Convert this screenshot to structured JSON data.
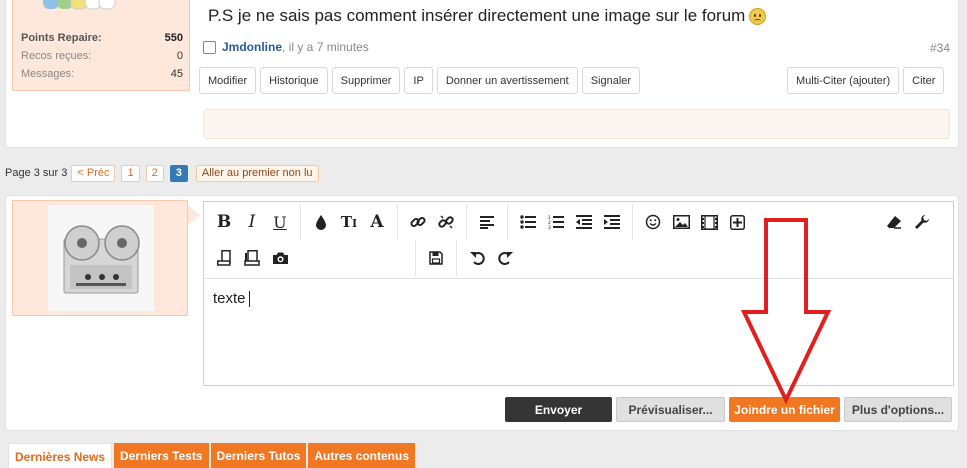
{
  "previous_post": {
    "user_stats": [
      {
        "label": "Points Repaire:",
        "value": "550",
        "bold": true
      },
      {
        "label": "Recos reçues:",
        "value": "0",
        "bold": false
      },
      {
        "label": "Messages:",
        "value": "45",
        "bold": false
      }
    ],
    "message": "P.S je ne sais pas comment insérer directement une image sur le forum",
    "emoji_icon": "worried-face-icon",
    "author": "Jmdonline",
    "time": ", il y a 7 minutes",
    "post_number": "#34",
    "actions_left": [
      "Modifier",
      "Historique",
      "Supprimer",
      "IP",
      "Donner un avertissement",
      "Signaler"
    ],
    "actions_right": [
      "Multi-Citer (ajouter)",
      "Citer"
    ]
  },
  "pagination": {
    "label": "Page 3 sur 3",
    "prev": "< Préc",
    "pages": [
      "1",
      "2",
      "3"
    ],
    "current": "3",
    "first_unread": "Aller au premier non lu"
  },
  "editor": {
    "toolbar_row1": [
      [
        "bold-icon",
        "italic-icon",
        "underline-icon"
      ],
      [
        "text-color-icon",
        "font-size-icon",
        "font-family-icon"
      ],
      [
        "link-icon",
        "unlink-icon"
      ],
      [
        "align-icon"
      ],
      [
        "bulleted-list-icon",
        "numbered-list-icon",
        "outdent-icon",
        "indent-icon"
      ],
      [
        "smilie-icon",
        "image-icon",
        "media-icon",
        "insert-icon"
      ]
    ],
    "toolbar_row1_right": [
      "remove-format-icon",
      "wrench-icon"
    ],
    "toolbar_row2": [
      [
        "template-icon",
        "toggle-bbcode-icon",
        "camera-icon"
      ],
      [
        "save-draft-icon"
      ],
      [
        "undo-icon",
        "redo-icon"
      ]
    ],
    "content": "texte"
  },
  "submit": {
    "send": "Envoyer",
    "preview": "Prévisualiser...",
    "attach": "Joindre un fichier",
    "more": "Plus d'options..."
  },
  "tabs": [
    {
      "label": "Dernières News",
      "active": true
    },
    {
      "label": "Derniers Tests",
      "active": false
    },
    {
      "label": "Derniers Tutos",
      "active": false
    },
    {
      "label": "Autres contenus",
      "active": false
    }
  ],
  "colors": {
    "accent": "#f07823",
    "link": "#2a5c99",
    "current_page": "#3579b6",
    "annotation_arrow": "#e02020"
  }
}
